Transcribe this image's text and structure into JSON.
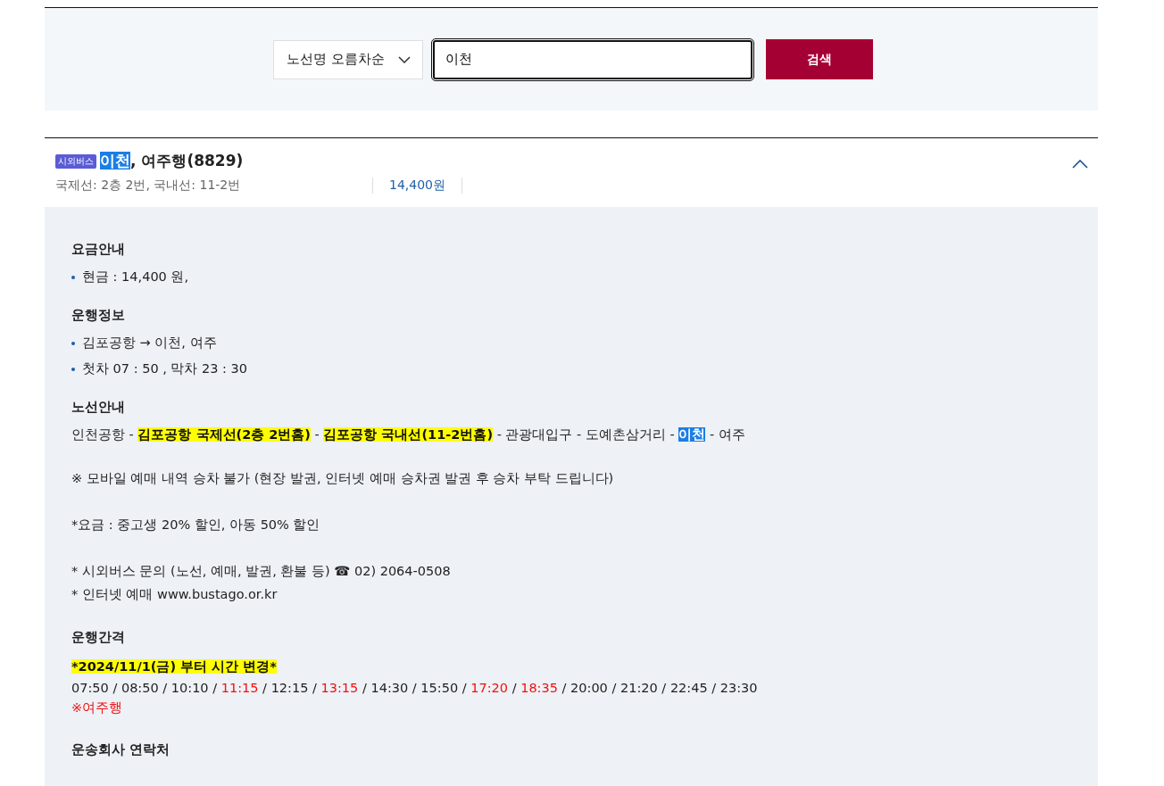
{
  "search": {
    "sort": "노선명 오름차순",
    "query": "이천",
    "button": "검색"
  },
  "route": {
    "badge": "시외버스",
    "title": [
      {
        "text": "이천",
        "kind": "match"
      },
      {
        "text": ", 여주행(8829)",
        "kind": "plain"
      }
    ],
    "stops": "국제선: 2층 2번, 국내선: 11-2번",
    "fare": "14,400원",
    "expanded": true
  },
  "sections": [
    {
      "heading": "요금안내",
      "bullets": [
        "현금 : 14,400 원,"
      ]
    },
    {
      "heading": "운행정보",
      "bullets": [
        "김포공항 → 이천, 여주",
        "첫차 07 : 50 , 막차 23 : 30"
      ]
    },
    {
      "heading": "노선안내",
      "route_line": [
        {
          "text": "인천공항 - ",
          "kind": "plain"
        },
        {
          "text": "김포공항 국제선(2층 2번홈)",
          "kind": "marked"
        },
        {
          "text": " - ",
          "kind": "plain"
        },
        {
          "text": "김포공항 국내선(11-2번홈)",
          "kind": "marked"
        },
        {
          "text": " - 관광대입구 - 도예촌삼거리 - ",
          "kind": "plain"
        },
        {
          "text": "이천",
          "kind": "match"
        },
        {
          "text": " - 여주",
          "kind": "plain"
        }
      ],
      "notes": [
        [
          "※ 모바일 예매 내역 승차 불가 (현장 발권, 인터넷 예매 승차권 발권 후 승차 부탁 드립니다)"
        ],
        [
          "*요금 : 중고생 20% 할인, 아동 50% 할인"
        ],
        [
          "* 시외버스 문의 (노선, 예매, 발권, 환불 등) ☎ 02) 2064-0508",
          "* 인터넷 예매 www.bustago.or.kr"
        ]
      ]
    },
    {
      "heading": "운행간격",
      "notice": "*2024/11/1(금) 부터 시간 변경*",
      "times": [
        {
          "text": "07:50",
          "highlighted": false
        },
        {
          "text": "08:50",
          "highlighted": false
        },
        {
          "text": "10:10",
          "highlighted": false
        },
        {
          "text": "11:15",
          "highlighted": true
        },
        {
          "text": "12:15",
          "highlighted": false
        },
        {
          "text": "13:15",
          "highlighted": true
        },
        {
          "text": "14:30",
          "highlighted": false
        },
        {
          "text": "15:50",
          "highlighted": false
        },
        {
          "text": "17:20",
          "highlighted": true
        },
        {
          "text": "18:35",
          "highlighted": true
        },
        {
          "text": "20:00",
          "highlighted": false
        },
        {
          "text": "21:20",
          "highlighted": false
        },
        {
          "text": "22:45",
          "highlighted": false
        },
        {
          "text": "23:30",
          "highlighted": false
        }
      ],
      "separator": " / ",
      "legend": "※여주행"
    },
    {
      "heading": "운송회사 연락처"
    }
  ]
}
